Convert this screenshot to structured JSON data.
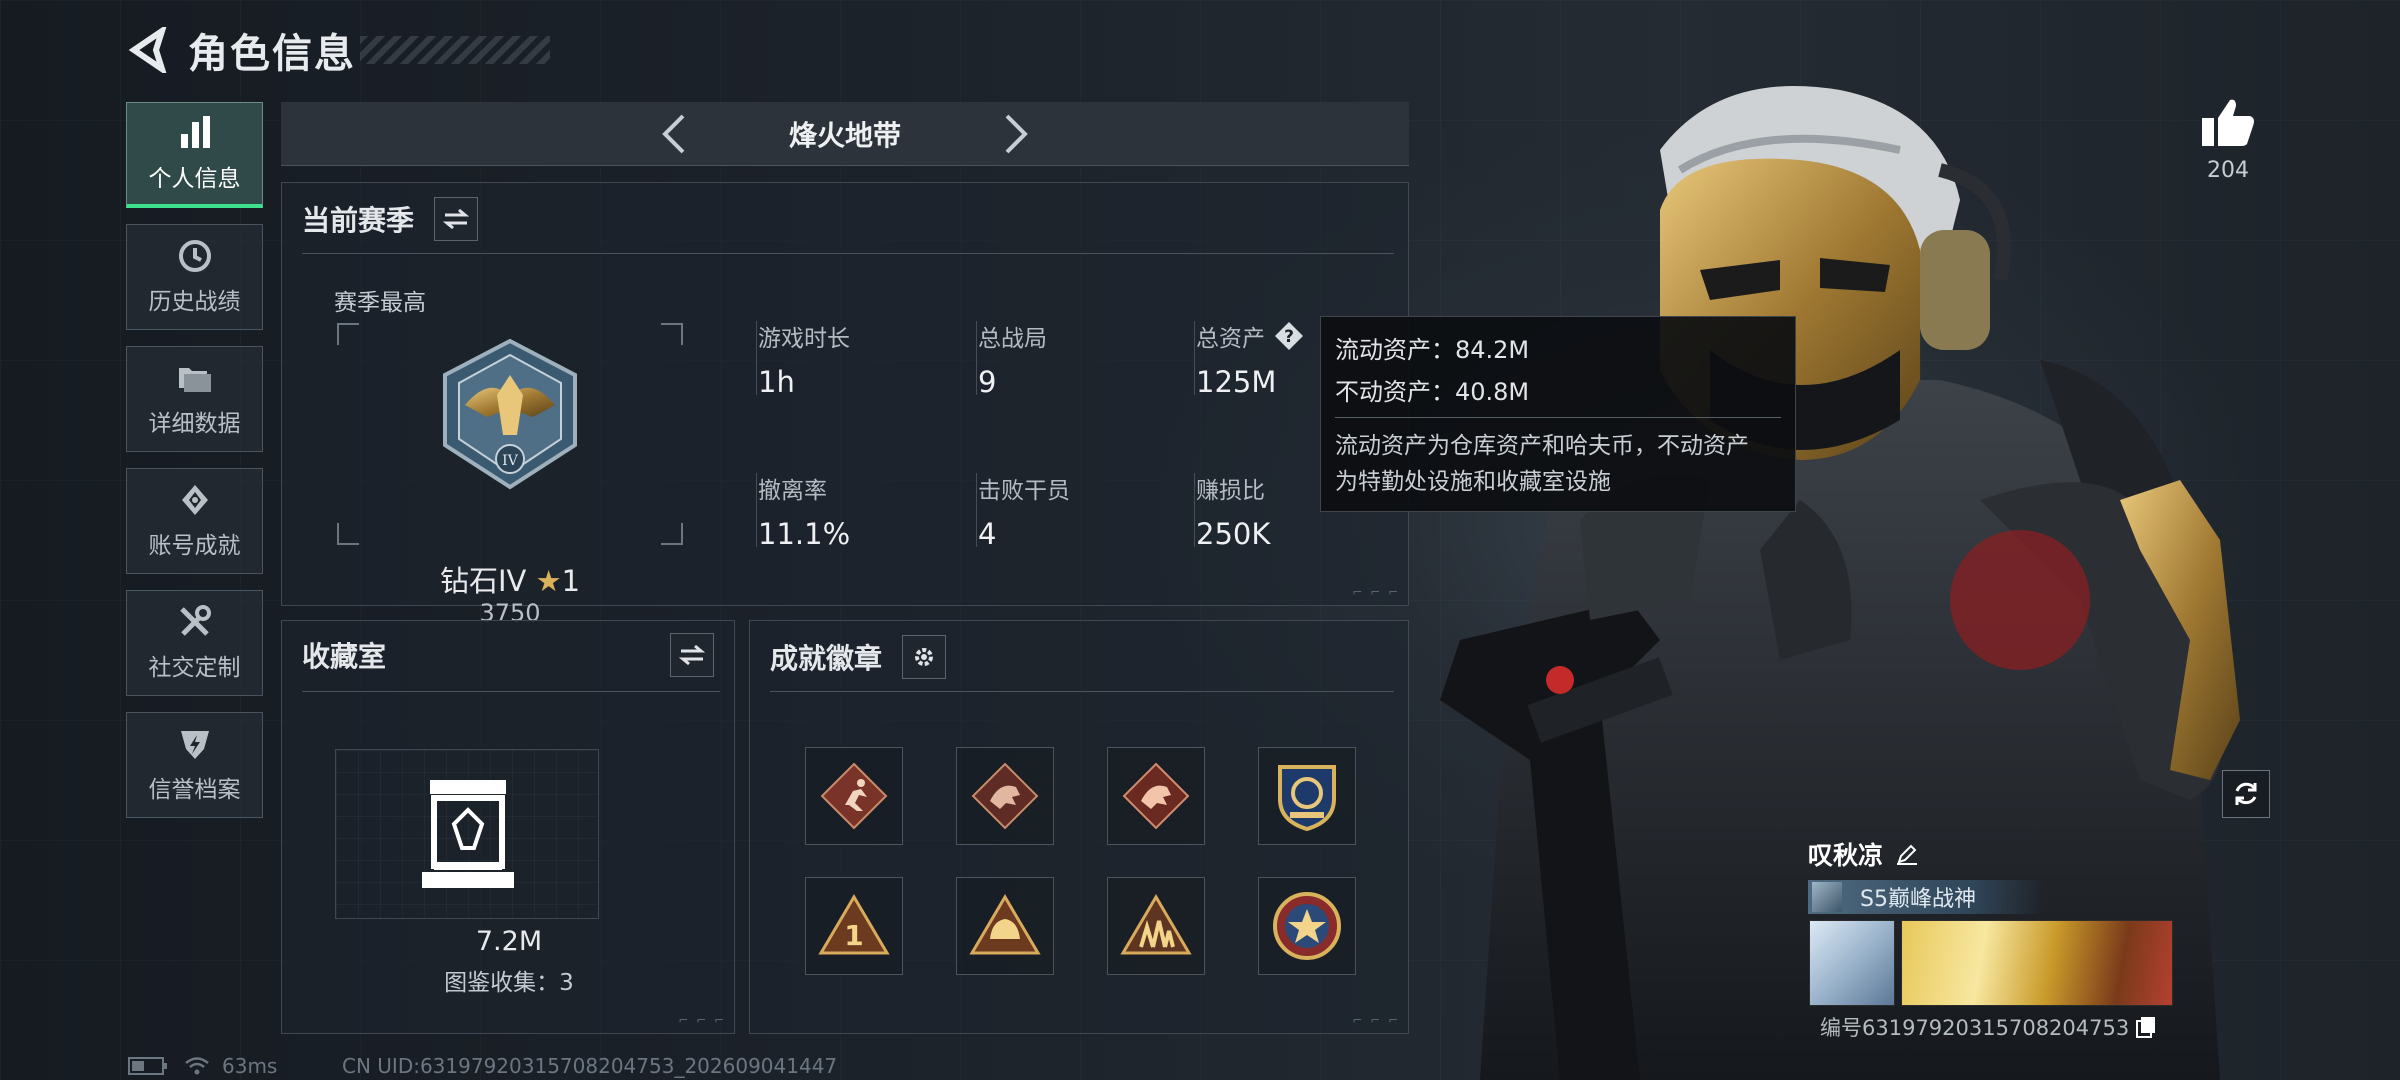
{
  "header": {
    "title": "角色信息"
  },
  "nav": [
    {
      "label": "个人信息",
      "icon": "bar-chart-icon",
      "active": true
    },
    {
      "label": "历史战绩",
      "icon": "history-clock-icon"
    },
    {
      "label": "详细数据",
      "icon": "folders-icon"
    },
    {
      "label": "账号成就",
      "icon": "achievement-icon"
    },
    {
      "label": "社交定制",
      "icon": "tools-icon"
    },
    {
      "label": "信誉档案",
      "icon": "shield-lightning-icon"
    }
  ],
  "mode": {
    "name": "烽火地带"
  },
  "season": {
    "title": "当前赛季",
    "best_label": "赛季最高",
    "rank_name": "钻石IV",
    "rank_stars": "1",
    "rank_points": "3750",
    "stats": {
      "playtime": {
        "label": "游戏时长",
        "value": "1h"
      },
      "matches": {
        "label": "总战局",
        "value": "9"
      },
      "assets": {
        "label": "总资产",
        "value": "125M"
      },
      "extract_rate": {
        "label": "撤离率",
        "value": "11.1%"
      },
      "kills": {
        "label": "击败干员",
        "value": "4"
      },
      "profit_ratio": {
        "label": "赚损比",
        "value": "250K"
      }
    }
  },
  "tooltip": {
    "liquid": "流动资产：84.2M",
    "fixed": "不动资产：40.8M",
    "desc_line1": "流动资产为仓库资产和哈夫币，不动资产",
    "desc_line2": "为特勤处设施和收藏室设施"
  },
  "collection": {
    "title": "收藏室",
    "value": "7.2M",
    "count": "图鉴收集：3"
  },
  "badges": {
    "title": "成就徽章",
    "items": [
      "runner-badge-icon",
      "dragon-badge-icon",
      "dragon-badge-icon-2",
      "eagle-shield-badge-icon",
      "number-one-badge-icon",
      "helmet-badge-icon",
      "squad-badge-icon",
      "star-medal-badge-icon"
    ]
  },
  "likes": {
    "count": "204"
  },
  "profile": {
    "name": "叹秋凉",
    "title": "S5巅峰战神",
    "uid": "编号63197920315708204753"
  },
  "footer": {
    "ping": "63ms",
    "cn_uid": "CN UID:63197920315708204753_202609041447"
  },
  "colors": {
    "accent": "#3fe08f",
    "panel_bg": "#1e252d",
    "gold": "#c9a25a"
  }
}
